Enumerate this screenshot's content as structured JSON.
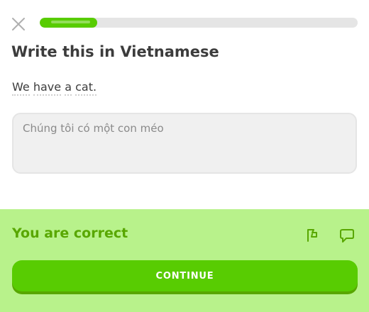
{
  "header": {
    "close_icon": "close-icon",
    "progress": 0.18
  },
  "challenge": {
    "title": "Write this in Vietnamese",
    "prompt_words": [
      "We",
      "have",
      "a",
      "cat."
    ],
    "answer_text": "Chúng tôi có một con méo"
  },
  "feedback": {
    "title": "You are correct",
    "report_icon": "flag-icon",
    "discuss_icon": "comment-icon",
    "continue_label": "CONTINUE"
  },
  "colors": {
    "accent_green": "#58cc02",
    "accent_green_dark": "#58a700",
    "feedback_bg": "#b8f28b",
    "progress_track": "#e5e5e5",
    "text_dark": "#3c3c3c",
    "input_bg": "#f0f0f0"
  }
}
